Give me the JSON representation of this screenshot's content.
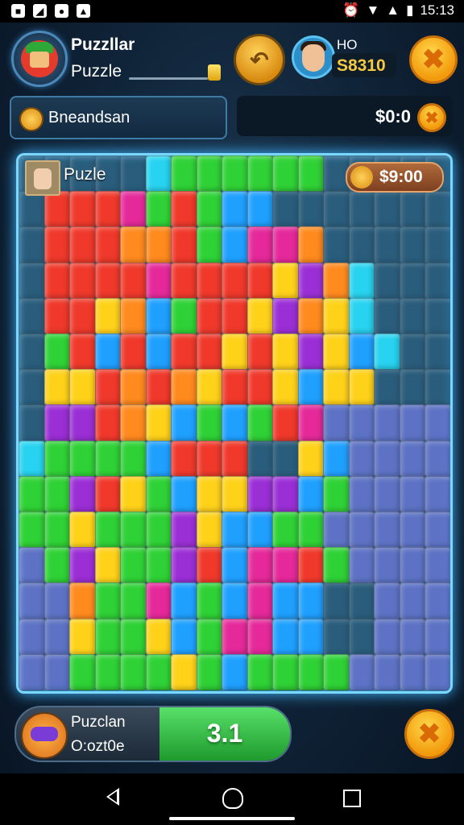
{
  "status_bar": {
    "time": "15:13",
    "left_icons": [
      "app-icon-1",
      "app-icon-2",
      "app-icon-3",
      "app-icon-4"
    ]
  },
  "header": {
    "title_line1": "Puzzllar",
    "title_line2": "Puzzle",
    "opponent_name": "HO",
    "opponent_score": "S8310"
  },
  "info_row": {
    "left_label": "Bneandsan",
    "right_value": "$0:0"
  },
  "board": {
    "label": "Puzle",
    "prize": "$9:00"
  },
  "bottom": {
    "label1": "Puzclan",
    "label2": "O:ozt0e",
    "value": "3.1"
  },
  "colors": {
    "red": "#f0392b",
    "orange": "#ff8a1e",
    "yellow": "#ffd21a",
    "green": "#2fd236",
    "blue": "#1fa0ff",
    "purple": "#9b2fd6",
    "magenta": "#e5299a",
    "cyan": "#27d3f0",
    "lavender": "#6b78d8",
    "dark": "#2a5d7c"
  },
  "puzzle_grid": [
    "DDDDDCGGGGGGDDDDD",
    "DRRRMGRGBBDDDDDDD",
    "DRRROORGBMMODDDDD",
    "DRRRRMRRRRYPOCDDD",
    "DRRYOBGRRYPOYCDDD",
    "DGRBRBRRYRYPYBCDD",
    "DYYROROYRRYBYYDDD",
    "DPPROYBGBGRMLLLLL",
    "CGGGGBRRRDDYBLLLL",
    "GGPRYGBYYPPBGLLLL",
    "GGYGGGPYBBGGLLLLL",
    "LGPYGGPRBMMRGLLLL",
    "LLOGGMBGBMBBDDLLL",
    "LLYGGYBGMMBBDDLLL",
    "LLGGGGYGBGGGGLLLL"
  ]
}
